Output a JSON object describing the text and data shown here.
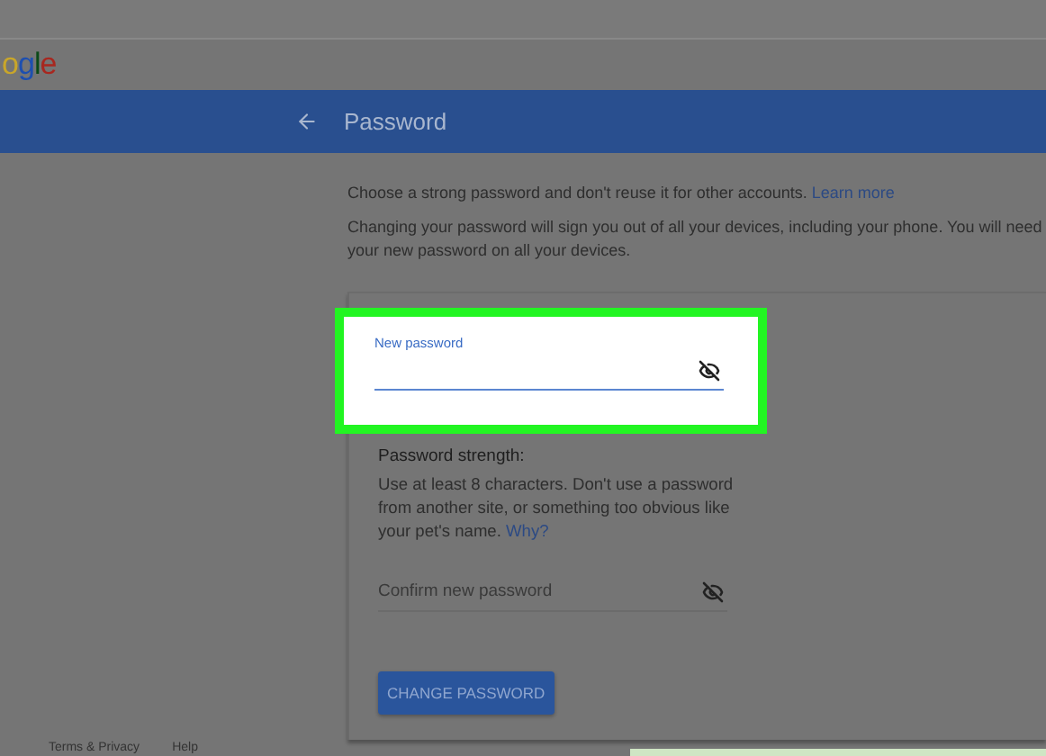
{
  "logo": {
    "letters": [
      {
        "char": "o",
        "color": "#c9a62a"
      },
      {
        "char": "g",
        "color": "#1d4fb0"
      },
      {
        "char": "l",
        "color": "#0b4a18"
      },
      {
        "char": "e",
        "color": "#a8271f"
      }
    ]
  },
  "header": {
    "title": "Password"
  },
  "intro": {
    "line1": "Choose a strong password and don't reuse it for other accounts.",
    "learn_more": "Learn more",
    "line2": "Changing your password will sign you out of all your devices, including your phone. You will need your new password on all your devices."
  },
  "new_password": {
    "label": "New password",
    "highlighted": true
  },
  "strength": {
    "heading": "Password strength:",
    "hint": "Use at least 8 characters. Don't use a password from another site, or something too obvious like your pet's name.",
    "why": "Why?"
  },
  "confirm_password": {
    "placeholder": "Confirm new password"
  },
  "button": "CHANGE PASSWORD",
  "footer": [
    "Terms & Privacy",
    "Help"
  ]
}
